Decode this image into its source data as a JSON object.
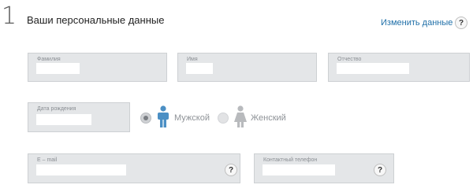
{
  "header": {
    "step_number": "1",
    "title": "Ваши персональные данные",
    "edit_link": "Изменить данные",
    "help_glyph": "?"
  },
  "fields": {
    "last_name": {
      "label": "Фамилия"
    },
    "first_name": {
      "label": "Имя"
    },
    "patronymic": {
      "label": "Отчество"
    },
    "birth_date": {
      "label": "Дата рождения"
    },
    "email": {
      "label": "E – mail",
      "help_glyph": "?"
    },
    "phone": {
      "label": "Контактный телефон",
      "help_glyph": "?"
    }
  },
  "gender": {
    "options": [
      {
        "label": "Мужской",
        "selected": true,
        "icon": "male-person-icon",
        "color": "#4b8fc4"
      },
      {
        "label": "Женский",
        "selected": false,
        "icon": "female-person-icon",
        "color": "#b8babd"
      }
    ]
  },
  "colors": {
    "accent": "#1f6fa8",
    "field_bg": "#e4e6e8"
  }
}
